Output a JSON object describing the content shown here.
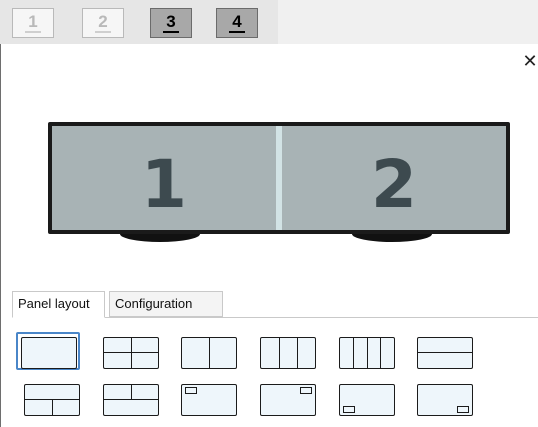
{
  "layer_tabs": [
    {
      "label": "1",
      "state": "disabled"
    },
    {
      "label": "2",
      "state": "disabled"
    },
    {
      "label": "3",
      "state": "active"
    },
    {
      "label": "4",
      "state": "active"
    }
  ],
  "close_glyph": "✕",
  "monitors": [
    {
      "label": "1"
    },
    {
      "label": "2"
    }
  ],
  "lower_tabs": [
    {
      "label": "Panel layout",
      "selected": true
    },
    {
      "label": "Configuration",
      "selected": false
    }
  ],
  "layouts": [
    {
      "id": "full",
      "selected": true
    },
    {
      "id": "quad",
      "selected": false
    },
    {
      "id": "two-columns",
      "selected": false
    },
    {
      "id": "three-columns",
      "selected": false
    },
    {
      "id": "four-columns",
      "selected": false
    },
    {
      "id": "two-rows",
      "selected": false
    },
    {
      "id": "top-full-bottom-split",
      "selected": false
    },
    {
      "id": "top-split-bottom-full",
      "selected": false
    },
    {
      "id": "pip-top-left",
      "selected": false
    },
    {
      "id": "pip-top-right",
      "selected": false
    },
    {
      "id": "pip-bottom-left",
      "selected": false
    },
    {
      "id": "pip-bottom-right",
      "selected": false
    }
  ],
  "colors": {
    "selection_accent": "#4a86c8",
    "screen_fill": "#a8b3b5",
    "monitor_bezel": "#1a1a1a"
  }
}
